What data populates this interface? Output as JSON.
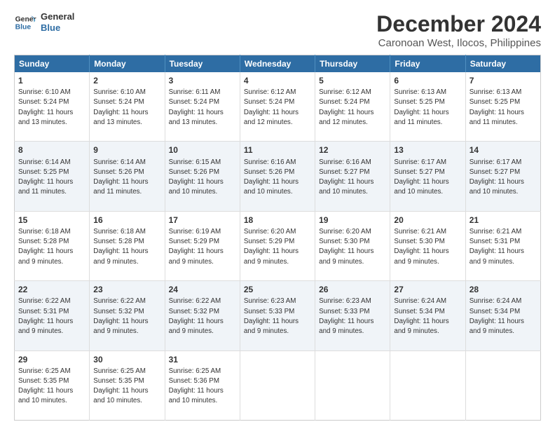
{
  "logo": {
    "line1": "General",
    "line2": "Blue"
  },
  "title": "December 2024",
  "subtitle": "Caronoan West, Ilocos, Philippines",
  "days": [
    "Sunday",
    "Monday",
    "Tuesday",
    "Wednesday",
    "Thursday",
    "Friday",
    "Saturday"
  ],
  "weeks": [
    [
      {
        "day": "1",
        "sunrise": "6:10 AM",
        "sunset": "5:24 PM",
        "daylight": "11 hours and 13 minutes."
      },
      {
        "day": "2",
        "sunrise": "6:10 AM",
        "sunset": "5:24 PM",
        "daylight": "11 hours and 13 minutes."
      },
      {
        "day": "3",
        "sunrise": "6:11 AM",
        "sunset": "5:24 PM",
        "daylight": "11 hours and 13 minutes."
      },
      {
        "day": "4",
        "sunrise": "6:12 AM",
        "sunset": "5:24 PM",
        "daylight": "11 hours and 12 minutes."
      },
      {
        "day": "5",
        "sunrise": "6:12 AM",
        "sunset": "5:24 PM",
        "daylight": "11 hours and 12 minutes."
      },
      {
        "day": "6",
        "sunrise": "6:13 AM",
        "sunset": "5:25 PM",
        "daylight": "11 hours and 11 minutes."
      },
      {
        "day": "7",
        "sunrise": "6:13 AM",
        "sunset": "5:25 PM",
        "daylight": "11 hours and 11 minutes."
      }
    ],
    [
      {
        "day": "8",
        "sunrise": "6:14 AM",
        "sunset": "5:25 PM",
        "daylight": "11 hours and 11 minutes."
      },
      {
        "day": "9",
        "sunrise": "6:14 AM",
        "sunset": "5:26 PM",
        "daylight": "11 hours and 11 minutes."
      },
      {
        "day": "10",
        "sunrise": "6:15 AM",
        "sunset": "5:26 PM",
        "daylight": "11 hours and 10 minutes."
      },
      {
        "day": "11",
        "sunrise": "6:16 AM",
        "sunset": "5:26 PM",
        "daylight": "11 hours and 10 minutes."
      },
      {
        "day": "12",
        "sunrise": "6:16 AM",
        "sunset": "5:27 PM",
        "daylight": "11 hours and 10 minutes."
      },
      {
        "day": "13",
        "sunrise": "6:17 AM",
        "sunset": "5:27 PM",
        "daylight": "11 hours and 10 minutes."
      },
      {
        "day": "14",
        "sunrise": "6:17 AM",
        "sunset": "5:27 PM",
        "daylight": "11 hours and 10 minutes."
      }
    ],
    [
      {
        "day": "15",
        "sunrise": "6:18 AM",
        "sunset": "5:28 PM",
        "daylight": "11 hours and 9 minutes."
      },
      {
        "day": "16",
        "sunrise": "6:18 AM",
        "sunset": "5:28 PM",
        "daylight": "11 hours and 9 minutes."
      },
      {
        "day": "17",
        "sunrise": "6:19 AM",
        "sunset": "5:29 PM",
        "daylight": "11 hours and 9 minutes."
      },
      {
        "day": "18",
        "sunrise": "6:20 AM",
        "sunset": "5:29 PM",
        "daylight": "11 hours and 9 minutes."
      },
      {
        "day": "19",
        "sunrise": "6:20 AM",
        "sunset": "5:30 PM",
        "daylight": "11 hours and 9 minutes."
      },
      {
        "day": "20",
        "sunrise": "6:21 AM",
        "sunset": "5:30 PM",
        "daylight": "11 hours and 9 minutes."
      },
      {
        "day": "21",
        "sunrise": "6:21 AM",
        "sunset": "5:31 PM",
        "daylight": "11 hours and 9 minutes."
      }
    ],
    [
      {
        "day": "22",
        "sunrise": "6:22 AM",
        "sunset": "5:31 PM",
        "daylight": "11 hours and 9 minutes."
      },
      {
        "day": "23",
        "sunrise": "6:22 AM",
        "sunset": "5:32 PM",
        "daylight": "11 hours and 9 minutes."
      },
      {
        "day": "24",
        "sunrise": "6:22 AM",
        "sunset": "5:32 PM",
        "daylight": "11 hours and 9 minutes."
      },
      {
        "day": "25",
        "sunrise": "6:23 AM",
        "sunset": "5:33 PM",
        "daylight": "11 hours and 9 minutes."
      },
      {
        "day": "26",
        "sunrise": "6:23 AM",
        "sunset": "5:33 PM",
        "daylight": "11 hours and 9 minutes."
      },
      {
        "day": "27",
        "sunrise": "6:24 AM",
        "sunset": "5:34 PM",
        "daylight": "11 hours and 9 minutes."
      },
      {
        "day": "28",
        "sunrise": "6:24 AM",
        "sunset": "5:34 PM",
        "daylight": "11 hours and 9 minutes."
      }
    ],
    [
      {
        "day": "29",
        "sunrise": "6:25 AM",
        "sunset": "5:35 PM",
        "daylight": "11 hours and 10 minutes."
      },
      {
        "day": "30",
        "sunrise": "6:25 AM",
        "sunset": "5:35 PM",
        "daylight": "11 hours and 10 minutes."
      },
      {
        "day": "31",
        "sunrise": "6:25 AM",
        "sunset": "5:36 PM",
        "daylight": "11 hours and 10 minutes."
      },
      null,
      null,
      null,
      null
    ]
  ],
  "labels": {
    "sunrise": "Sunrise:",
    "sunset": "Sunset:",
    "daylight": "Daylight:"
  }
}
